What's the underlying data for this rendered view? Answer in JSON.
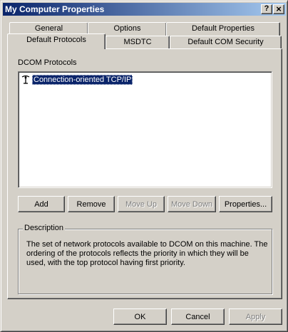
{
  "window": {
    "title": "My Computer Properties",
    "help_glyph": "?",
    "close_glyph": "×"
  },
  "tabs_back": [
    "General",
    "Options",
    "Default Properties"
  ],
  "tabs_front": [
    "Default Protocols",
    "MSDTC",
    "Default COM Security"
  ],
  "active_tab": "Default Protocols",
  "panel": {
    "protocols_label": "DCOM Protocols",
    "protocols": [
      "Connection-oriented TCP/IP"
    ],
    "buttons": {
      "add": "Add",
      "remove": "Remove",
      "move_up": "Move Up",
      "move_down": "Move Down",
      "properties": "Properties..."
    },
    "description_legend": "Description",
    "description_text": "The set of network protocols available to DCOM on this machine. The ordering of the protocols reflects the priority in which they will be used, with the top protocol having first priority."
  },
  "footer": {
    "ok": "OK",
    "cancel": "Cancel",
    "apply": "Apply"
  },
  "colors": {
    "titlebar_start": "#0a246a",
    "titlebar_end": "#a6caf0",
    "face": "#d4d0c8",
    "selection": "#0a246a"
  }
}
